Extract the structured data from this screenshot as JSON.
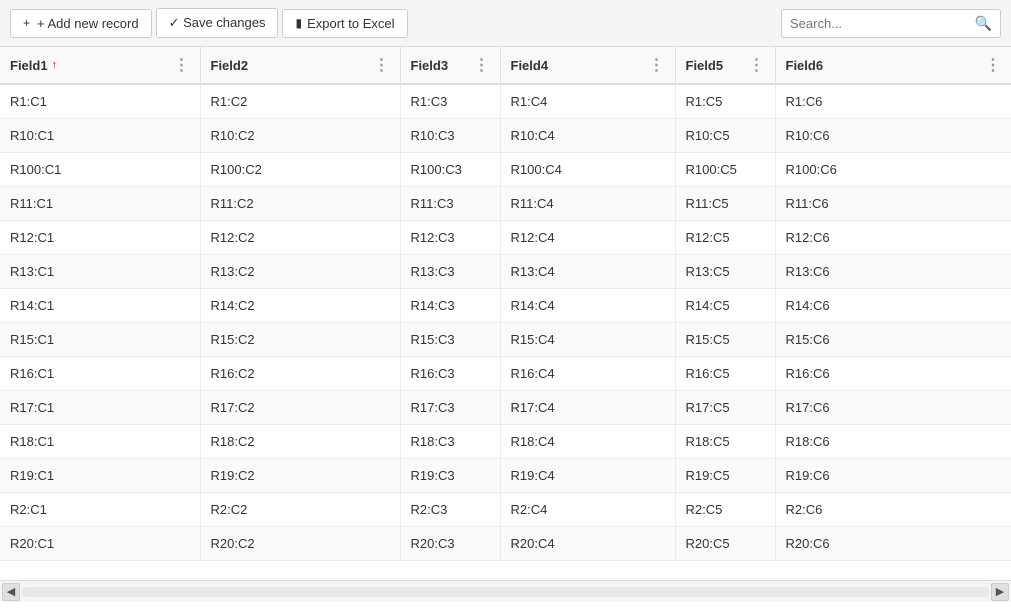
{
  "toolbar": {
    "add_label": "+ Add new record",
    "save_label": "✓ Save changes",
    "export_label": "Export to Excel",
    "search_placeholder": "Search..."
  },
  "columns": [
    {
      "id": "field1",
      "label": "Field1",
      "sortable": true,
      "sort_dir": "asc"
    },
    {
      "id": "field2",
      "label": "Field2",
      "sortable": false
    },
    {
      "id": "field3",
      "label": "Field3",
      "sortable": false
    },
    {
      "id": "field4",
      "label": "Field4",
      "sortable": false
    },
    {
      "id": "field5",
      "label": "Field5",
      "sortable": false
    },
    {
      "id": "field6",
      "label": "Field6",
      "sortable": false
    }
  ],
  "rows": [
    [
      "R1:C1",
      "R1:C2",
      "R1:C3",
      "R1:C4",
      "R1:C5",
      "R1:C6"
    ],
    [
      "R10:C1",
      "R10:C2",
      "R10:C3",
      "R10:C4",
      "R10:C5",
      "R10:C6"
    ],
    [
      "R100:C1",
      "R100:C2",
      "R100:C3",
      "R100:C4",
      "R100:C5",
      "R100:C6"
    ],
    [
      "R11:C1",
      "R11:C2",
      "R11:C3",
      "R11:C4",
      "R11:C5",
      "R11:C6"
    ],
    [
      "R12:C1",
      "R12:C2",
      "R12:C3",
      "R12:C4",
      "R12:C5",
      "R12:C6"
    ],
    [
      "R13:C1",
      "R13:C2",
      "R13:C3",
      "R13:C4",
      "R13:C5",
      "R13:C6"
    ],
    [
      "R14:C1",
      "R14:C2",
      "R14:C3",
      "R14:C4",
      "R14:C5",
      "R14:C6"
    ],
    [
      "R15:C1",
      "R15:C2",
      "R15:C3",
      "R15:C4",
      "R15:C5",
      "R15:C6"
    ],
    [
      "R16:C1",
      "R16:C2",
      "R16:C3",
      "R16:C4",
      "R16:C5",
      "R16:C6"
    ],
    [
      "R17:C1",
      "R17:C2",
      "R17:C3",
      "R17:C4",
      "R17:C5",
      "R17:C6"
    ],
    [
      "R18:C1",
      "R18:C2",
      "R18:C3",
      "R18:C4",
      "R18:C5",
      "R18:C6"
    ],
    [
      "R19:C1",
      "R19:C2",
      "R19:C3",
      "R19:C4",
      "R19:C5",
      "R19:C6"
    ],
    [
      "R2:C1",
      "R2:C2",
      "R2:C3",
      "R2:C4",
      "R2:C5",
      "R2:C6"
    ],
    [
      "R20:C1",
      "R20:C2",
      "R20:C3",
      "R20:C4",
      "R20:C5",
      "R20:C6"
    ]
  ]
}
